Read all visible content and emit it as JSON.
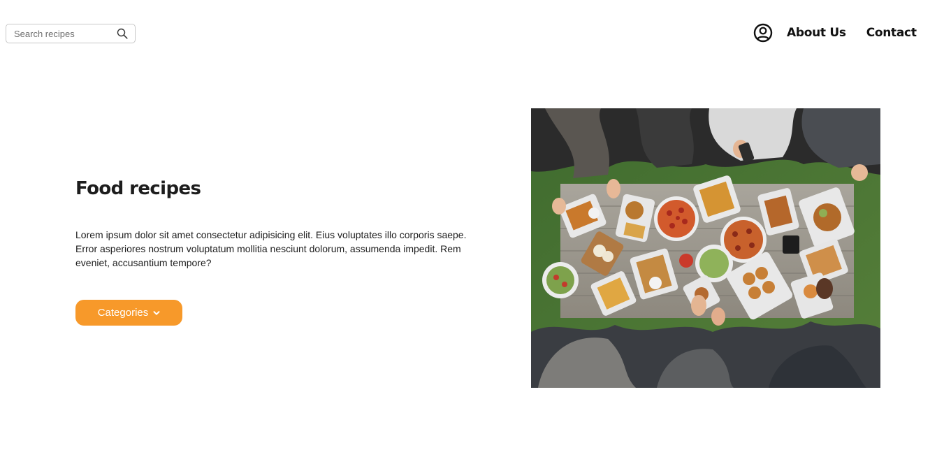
{
  "header": {
    "search": {
      "placeholder": "Search recipes",
      "value": "",
      "icon": "search-icon"
    },
    "nav": {
      "account_icon": "user-circle-icon",
      "links": [
        {
          "label": "About Us"
        },
        {
          "label": "Contact"
        }
      ]
    }
  },
  "hero": {
    "title": "Food recipes",
    "description": "Lorem ipsum dolor sit amet consectetur adipisicing elit. Eius voluptates illo corporis saepe. Error asperiores nostrum voluptatum mollitia nesciunt dolorum, assumenda impedit. Rem eveniet, accusantium tempore?",
    "button": {
      "label": "Categories",
      "icon": "chevron-down-icon"
    },
    "image": {
      "subject": "overhead photo of friends sharing a table of food"
    }
  },
  "colors": {
    "accent": "#f7992a",
    "text": "#1d1d1d",
    "background": "#ffffff"
  }
}
